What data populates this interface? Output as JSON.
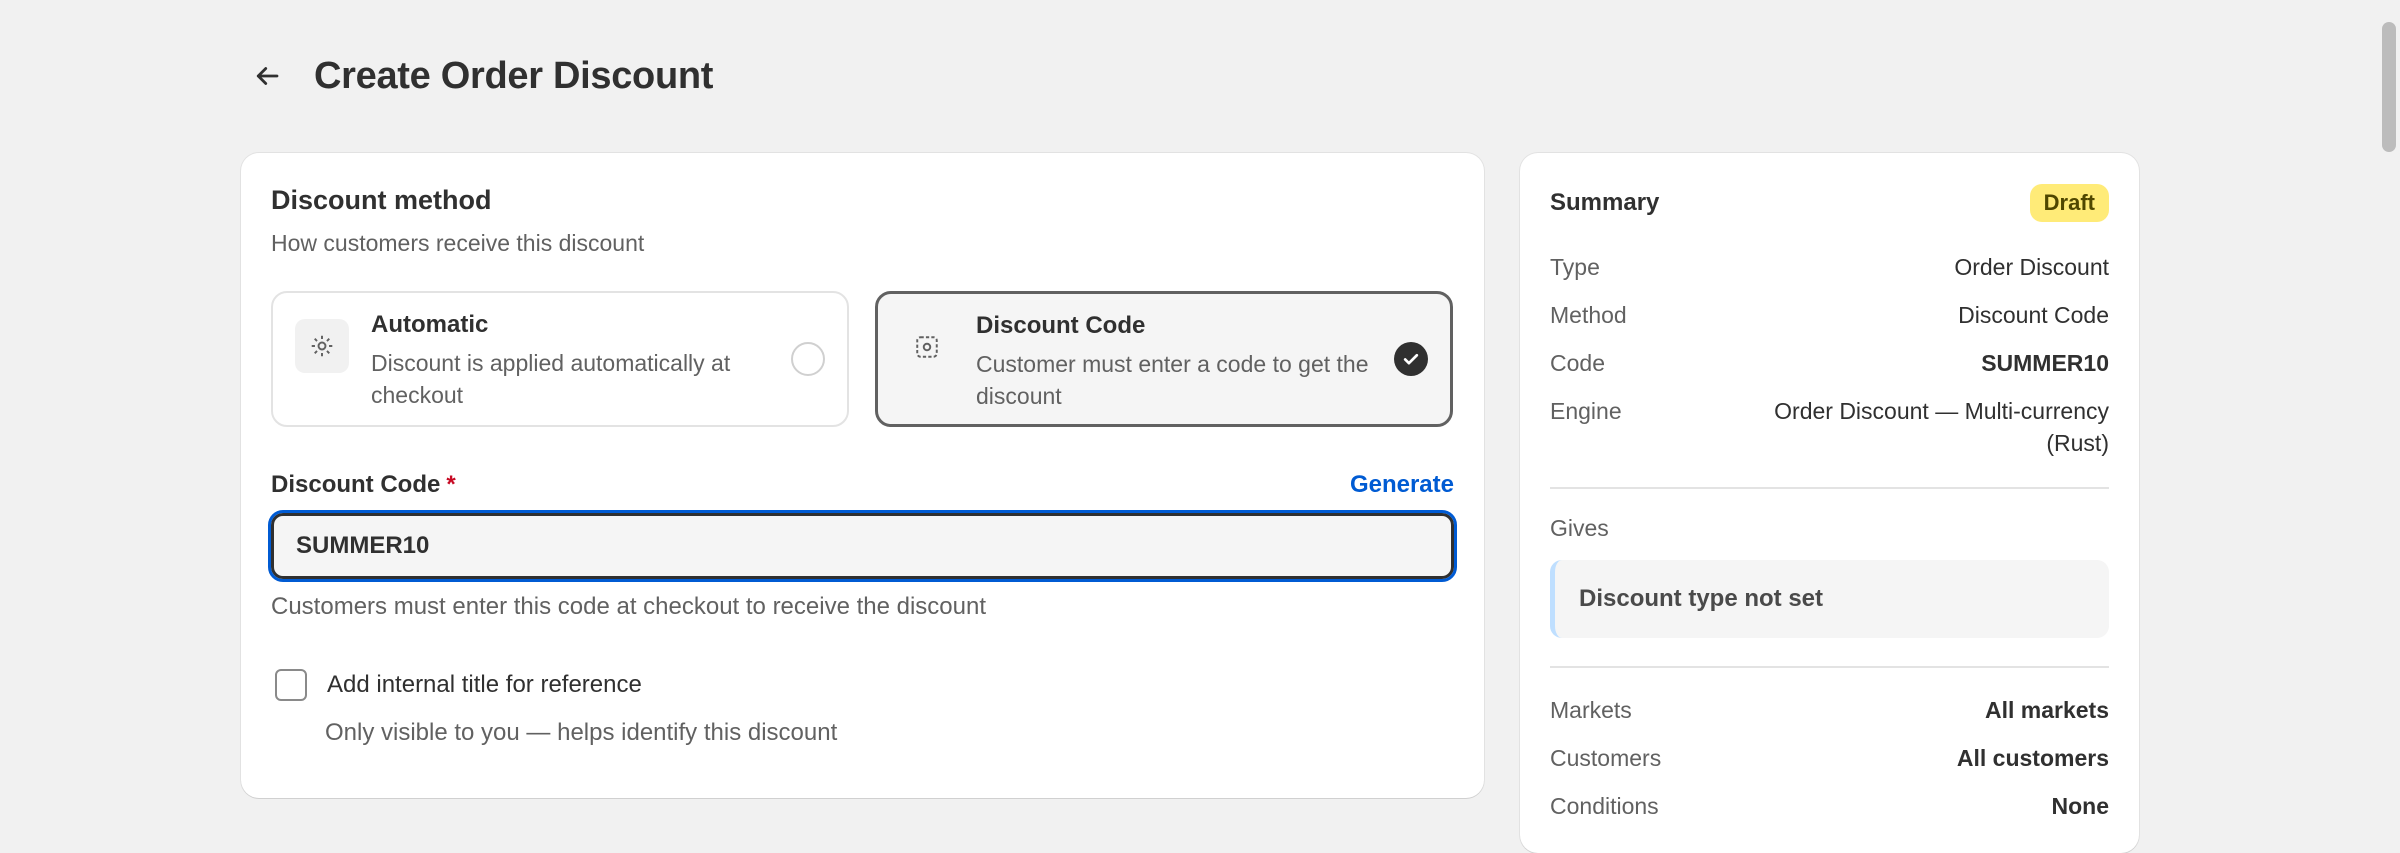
{
  "header": {
    "title": "Create Order Discount"
  },
  "method_section": {
    "title": "Discount method",
    "subtitle": "How customers receive this discount",
    "options": [
      {
        "title": "Automatic",
        "description": "Discount is applied automatically at checkout",
        "icon": "gear-icon",
        "selected": false
      },
      {
        "title": "Discount Code",
        "description": "Customer must enter a code to get the discount",
        "icon": "code-icon",
        "selected": true
      }
    ]
  },
  "code_field": {
    "label": "Discount Code",
    "required_mark": "*",
    "generate_label": "Generate",
    "value": "SUMMER10",
    "help": "Customers must enter this code at checkout to receive the discount"
  },
  "internal_title": {
    "label": "Add internal title for reference",
    "help": "Only visible to you — helps identify this discount",
    "checked": false
  },
  "summary": {
    "title": "Summary",
    "badge": "Draft",
    "rows": [
      {
        "key": "Type",
        "value": "Order Discount"
      },
      {
        "key": "Method",
        "value": "Discount Code"
      },
      {
        "key": "Code",
        "value": "SUMMER10"
      },
      {
        "key": "Engine",
        "value": "Order Discount — Multi-currency (Rust)"
      }
    ],
    "gives_label": "Gives",
    "gives_value": "Discount type not set",
    "rows2": [
      {
        "key": "Markets",
        "value": "All markets"
      },
      {
        "key": "Customers",
        "value": "All customers"
      },
      {
        "key": "Conditions",
        "value": "None"
      }
    ]
  },
  "colors": {
    "accent": "#005bd3",
    "badge_bg": "#ffeb78",
    "required": "#c70a24"
  }
}
